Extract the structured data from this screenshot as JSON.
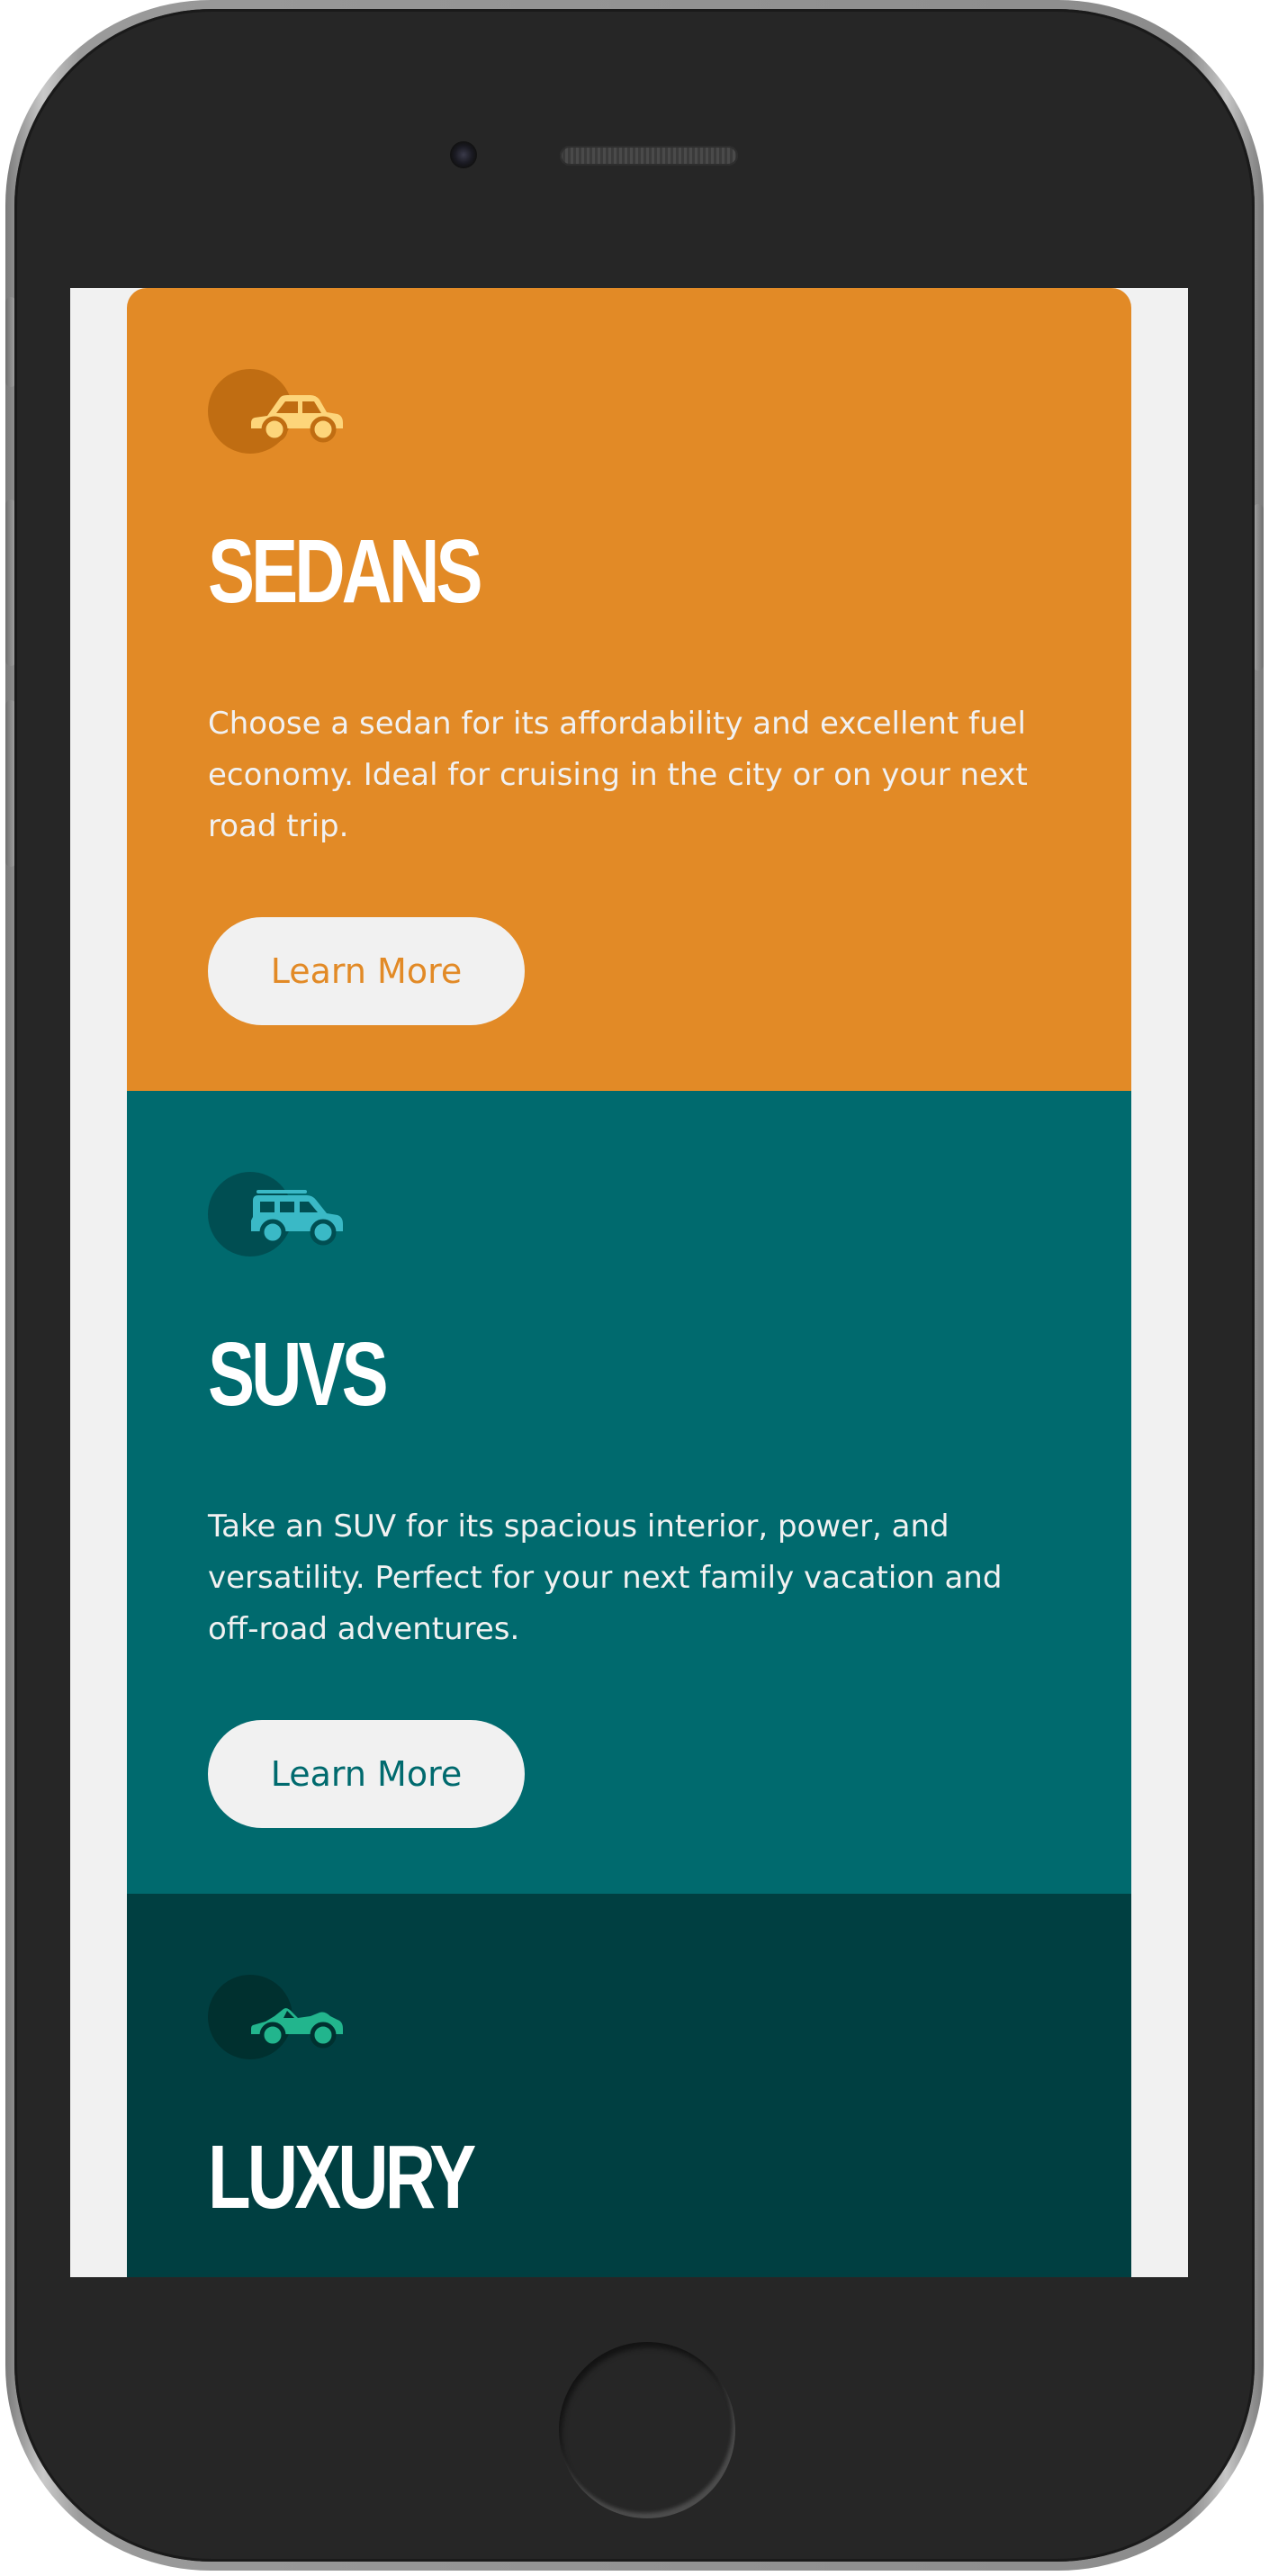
{
  "colors": {
    "sedans_bg": "#e28a26",
    "suvs_bg": "#006a6e",
    "luxury_bg": "#003f41",
    "button_bg": "#f1f1f1",
    "body_text": "#f1f1f1"
  },
  "cards": [
    {
      "icon": "sedan-car-icon",
      "title": "SEDANS",
      "text": "Choose a sedan for its affordability and excellent fuel economy. Ideal for cruising in the city or on your next road trip.",
      "button_label": "Learn More"
    },
    {
      "icon": "suv-car-icon",
      "title": "SUVS",
      "text": "Take an SUV for its spacious interior, power, and versatility. Perfect for your next family vacation and off-road adventures.",
      "button_label": "Learn More"
    },
    {
      "icon": "luxury-car-icon",
      "title": "LUXURY"
    }
  ]
}
